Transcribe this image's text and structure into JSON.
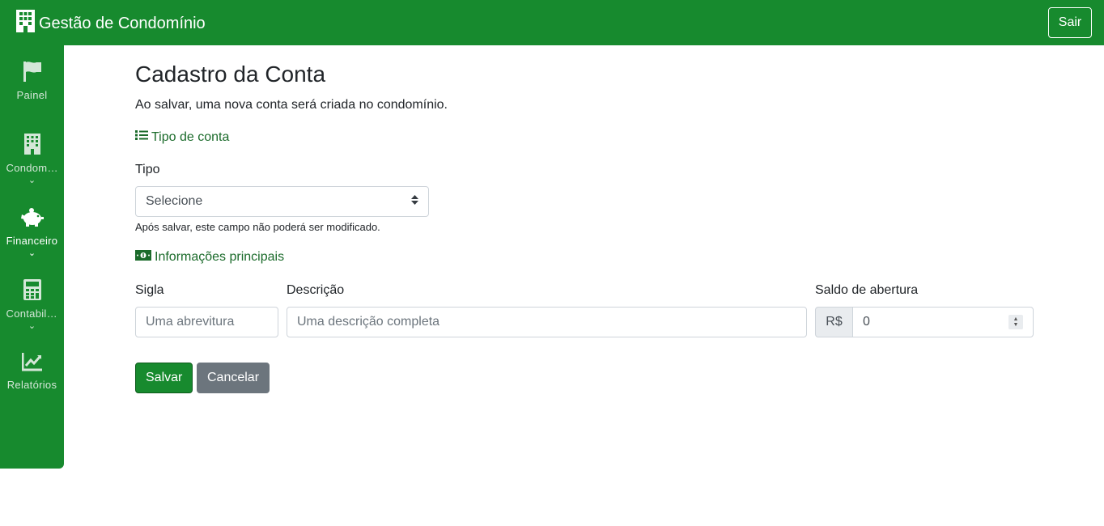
{
  "app": {
    "title": "Gestão de Condomínio",
    "logout_label": "Sair"
  },
  "sidebar": {
    "items": [
      {
        "label": "Painel",
        "icon": "flag-icon",
        "has_submenu": false
      },
      {
        "label": "Condomínios",
        "icon": "building-icon",
        "has_submenu": true
      },
      {
        "label": "Financeiro",
        "icon": "piggy-bank-icon",
        "has_submenu": true,
        "active": true
      },
      {
        "label": "Contabilidade",
        "icon": "calculator-icon",
        "has_submenu": true
      },
      {
        "label": "Relatórios",
        "icon": "chart-line-icon",
        "has_submenu": false
      }
    ],
    "caret": "⌄"
  },
  "page": {
    "title": "Cadastro da Conta",
    "subtitle": "Ao salvar, uma nova conta será criada no condomínio."
  },
  "section_tipo": {
    "heading": "Tipo de conta",
    "icon": "list-icon",
    "tipo_label": "Tipo",
    "tipo_value": "Selecione",
    "help": "Após salvar, este campo não poderá ser modificado."
  },
  "section_info": {
    "heading": "Informações principais",
    "icon": "money-bill-icon",
    "sigla_label": "Sigla",
    "sigla_placeholder": "Uma abrevitura",
    "descricao_label": "Descrição",
    "descricao_placeholder": "Uma descrição completa",
    "saldo_label": "Saldo de abertura",
    "saldo_prefix": "R$",
    "saldo_value": "0"
  },
  "actions": {
    "save_label": "Salvar",
    "cancel_label": "Cancelar"
  },
  "colors": {
    "primary": "#178a2e",
    "link": "#1b6b2b",
    "secondary": "#6c757d"
  }
}
